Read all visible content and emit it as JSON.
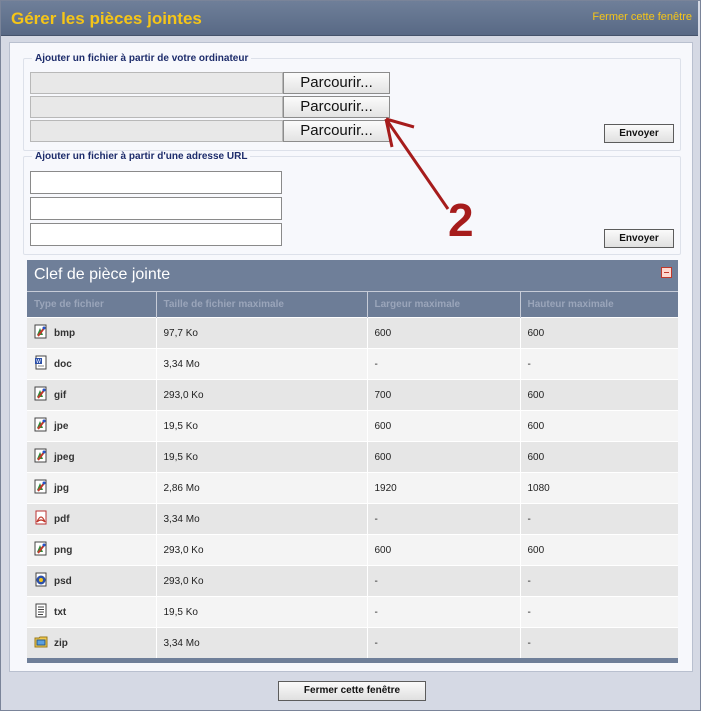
{
  "header": {
    "title": "Gérer les pièces jointes",
    "close_link": "Fermer cette fenêtre"
  },
  "upload_computer": {
    "legend": "Ajouter un fichier à partir de votre ordinateur",
    "browse_label": "Parcourir...",
    "send_label": "Envoyer"
  },
  "upload_url": {
    "legend": "Ajouter un fichier à partir d'une adresse URL",
    "send_label": "Envoyer"
  },
  "annotation": {
    "number": "2",
    "color": "#a61c1c"
  },
  "key": {
    "title": "Clef de pièce jointe",
    "columns": [
      "Type de fichier",
      "Taille de fichier maximale",
      "Largeur maximale",
      "Hauteur maximale"
    ],
    "rows": [
      {
        "type": "bmp",
        "icon": "image-file-icon",
        "size": "97,7 Ko",
        "width": "600",
        "height": "600"
      },
      {
        "type": "doc",
        "icon": "word-file-icon",
        "size": "3,34 Mo",
        "width": "-",
        "height": "-"
      },
      {
        "type": "gif",
        "icon": "image-file-icon",
        "size": "293,0 Ko",
        "width": "700",
        "height": "600"
      },
      {
        "type": "jpe",
        "icon": "image-file-icon",
        "size": "19,5 Ko",
        "width": "600",
        "height": "600"
      },
      {
        "type": "jpeg",
        "icon": "image-file-icon",
        "size": "19,5 Ko",
        "width": "600",
        "height": "600"
      },
      {
        "type": "jpg",
        "icon": "image-file-icon",
        "size": "2,86 Mo",
        "width": "1920",
        "height": "1080"
      },
      {
        "type": "pdf",
        "icon": "pdf-file-icon",
        "size": "3,34 Mo",
        "width": "-",
        "height": "-"
      },
      {
        "type": "png",
        "icon": "image-file-icon",
        "size": "293,0 Ko",
        "width": "600",
        "height": "600"
      },
      {
        "type": "psd",
        "icon": "psd-file-icon",
        "size": "293,0 Ko",
        "width": "-",
        "height": "-"
      },
      {
        "type": "txt",
        "icon": "text-file-icon",
        "size": "19,5 Ko",
        "width": "-",
        "height": "-"
      },
      {
        "type": "zip",
        "icon": "zip-file-icon",
        "size": "3,34 Mo",
        "width": "-",
        "height": "-"
      }
    ]
  },
  "footer": {
    "close_button": "Fermer cette fenêtre"
  },
  "colors": {
    "header_bg": "#586985",
    "title_yellow": "#f5c518",
    "panel_bg": "#6f7f99"
  }
}
